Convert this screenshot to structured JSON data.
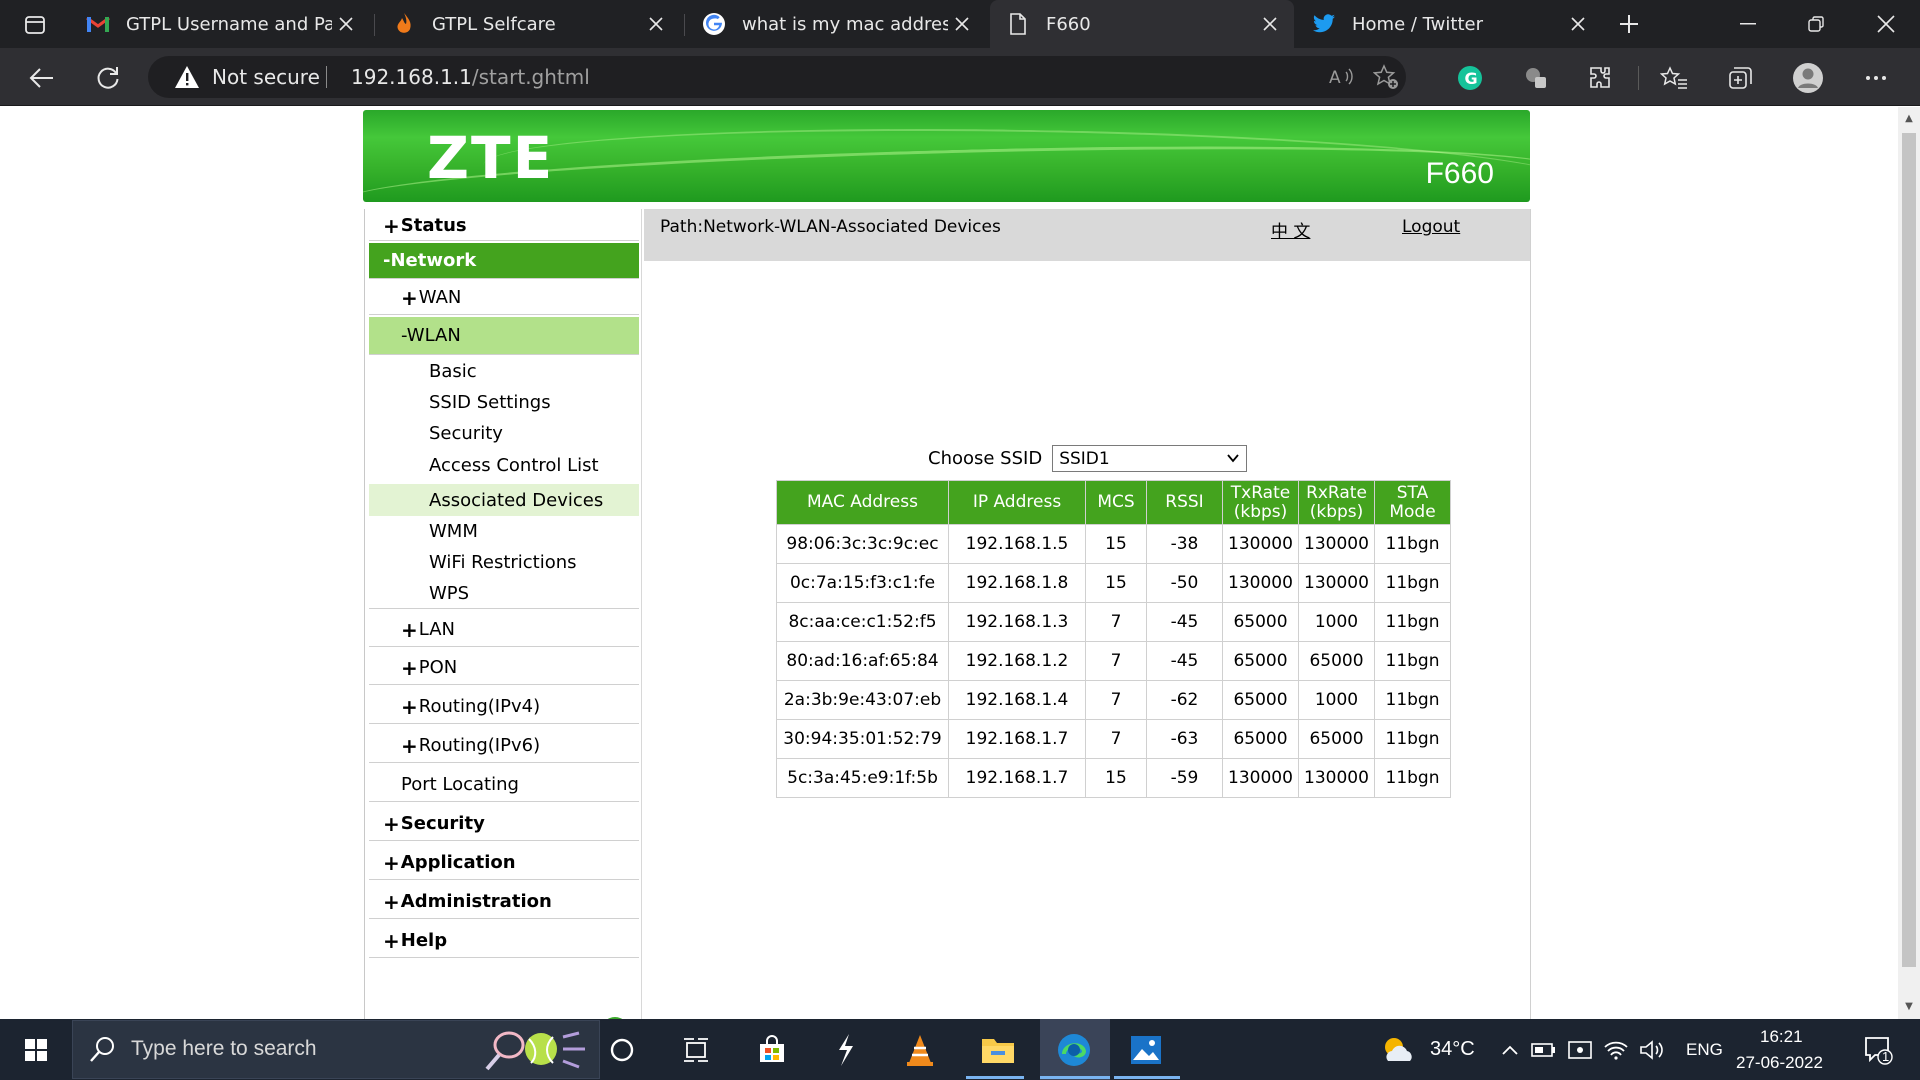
{
  "browser": {
    "tabs": [
      {
        "title": "GTPL Username and Passw",
        "icon": "gmail-icon"
      },
      {
        "title": "GTPL Selfcare",
        "icon": "flame-icon"
      },
      {
        "title": "what is my mac address w",
        "icon": "google-icon"
      },
      {
        "title": "F660",
        "icon": "page-icon",
        "active": true
      },
      {
        "title": "Home / Twitter",
        "icon": "twitter-icon"
      }
    ],
    "security_label": "Not secure",
    "url_host": "192.168.1.1",
    "url_path": "/start.ghtml"
  },
  "router": {
    "brand": "ZTE",
    "model": "F660"
  },
  "sidebar": {
    "status": "Status",
    "network": "-Network",
    "wan": "WAN",
    "wlan": "-WLAN",
    "wlan_items": [
      "Basic",
      "SSID Settings",
      "Security",
      "Access Control List",
      "Associated Devices",
      "WMM",
      "WiFi Restrictions",
      "WPS"
    ],
    "lan": "LAN",
    "pon": "PON",
    "routing4": "Routing(IPv4)",
    "routing6": "Routing(IPv6)",
    "port_locating": "Port Locating",
    "security": "Security",
    "application": "Application",
    "administration": "Administration",
    "help": "Help",
    "plus": "+"
  },
  "pathbar": {
    "path": "Path:Network-WLAN-Associated Devices",
    "language": "中 文",
    "logout": "Logout"
  },
  "ssid": {
    "label": "Choose SSID",
    "selected": "SSID1"
  },
  "table": {
    "headers": [
      "MAC Address",
      "IP Address",
      "MCS",
      "RSSI",
      "TxRate (kbps)",
      "RxRate (kbps)",
      "STA Mode"
    ],
    "rows": [
      [
        "98:06:3c:3c:9c:ec",
        "192.168.1.5",
        "15",
        "-38",
        "130000",
        "130000",
        "11bgn"
      ],
      [
        "0c:7a:15:f3:c1:fe",
        "192.168.1.8",
        "15",
        "-50",
        "130000",
        "130000",
        "11bgn"
      ],
      [
        "8c:aa:ce:c1:52:f5",
        "192.168.1.3",
        "7",
        "-45",
        "65000",
        "1000",
        "11bgn"
      ],
      [
        "80:ad:16:af:65:84",
        "192.168.1.2",
        "7",
        "-45",
        "65000",
        "65000",
        "11bgn"
      ],
      [
        "2a:3b:9e:43:07:eb",
        "192.168.1.4",
        "7",
        "-62",
        "65000",
        "1000",
        "11bgn"
      ],
      [
        "30:94:35:01:52:79",
        "192.168.1.7",
        "7",
        "-63",
        "65000",
        "65000",
        "11bgn"
      ],
      [
        "5c:3a:45:e9:1f:5b",
        "192.168.1.7",
        "15",
        "-59",
        "130000",
        "130000",
        "11bgn"
      ]
    ]
  },
  "taskbar": {
    "search_placeholder": "Type here to search",
    "temperature": "34°C",
    "language": "ENG",
    "time": "16:21",
    "date": "27-06-2022",
    "notification_count": "1"
  },
  "colors": {
    "zte_green": "#44a31e",
    "selected_light_green": "#b2e18a",
    "hover_green": "#e3f3d3",
    "browser_dark": "#202124"
  }
}
